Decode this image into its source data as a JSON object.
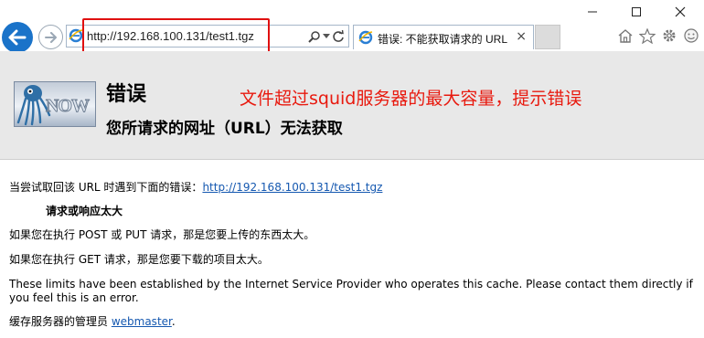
{
  "browser": {
    "address_url": "http://192.168.100.131/test1.tgz",
    "tab_title": "错误: 不能获取请求的 URL",
    "tab_close": "×",
    "window_controls": [
      "minimize-icon",
      "maximize-icon",
      "close-icon"
    ],
    "right_icons": [
      "home-icon",
      "star-icon",
      "gear-icon",
      "smiley-icon"
    ],
    "accent_color": "#1a73c9"
  },
  "banner": {
    "logo_text": "NOW",
    "title": "错误",
    "subtitle": "您所请求的网址（URL）无法获取",
    "annotation": "文件超过squid服务器的最大容量，提示错误",
    "annotation_color": "#e8190e"
  },
  "content": {
    "intro_prefix": "当尝试取回该 URL 时遇到下面的错误：",
    "intro_link": "http://192.168.100.131/test1.tgz",
    "error_heading": "请求或响应太大",
    "post_put": "如果您在执行 POST 或 PUT 请求，那是您要上传的东西太大。",
    "get": "如果您在执行 GET 请求，那是您要下载的项目太大。",
    "limits": "These limits have been established by the Internet Service Provider who operates this cache. Please contact them directly if you feel this is an error.",
    "admin_prefix": "缓存服务器的管理员 ",
    "admin_link": "webmaster",
    "admin_suffix": "."
  }
}
